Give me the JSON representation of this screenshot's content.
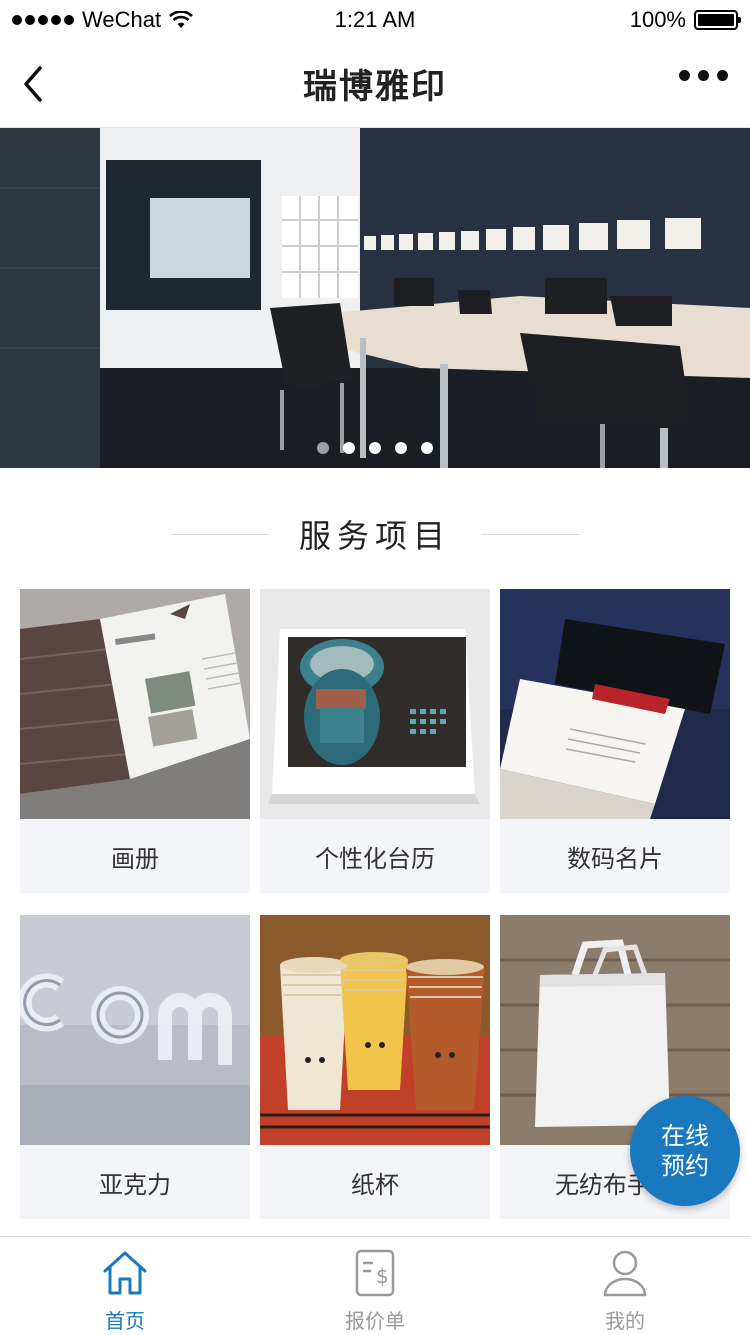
{
  "status_bar": {
    "carrier": "WeChat",
    "time": "1:21 AM",
    "battery": "100%"
  },
  "nav": {
    "title": "瑞博雅印"
  },
  "banner": {
    "slide_count": 5,
    "active_index": 1
  },
  "section": {
    "title": "服务项目"
  },
  "services": [
    {
      "label": "画册"
    },
    {
      "label": "个性化台历"
    },
    {
      "label": "数码名片"
    },
    {
      "label": "亚克力"
    },
    {
      "label": "纸杯"
    },
    {
      "label": "无纺布手提"
    }
  ],
  "fab": {
    "line1": "在线",
    "line2": "预约"
  },
  "tabs": [
    {
      "label": "首页",
      "icon": "home-icon",
      "active": true
    },
    {
      "label": "报价单",
      "icon": "quote-icon",
      "active": false
    },
    {
      "label": "我的",
      "icon": "user-icon",
      "active": false
    }
  ],
  "colors": {
    "accent": "#1a79be",
    "inactive": "#9a9a9a",
    "card_bg": "#f3f5f9"
  }
}
